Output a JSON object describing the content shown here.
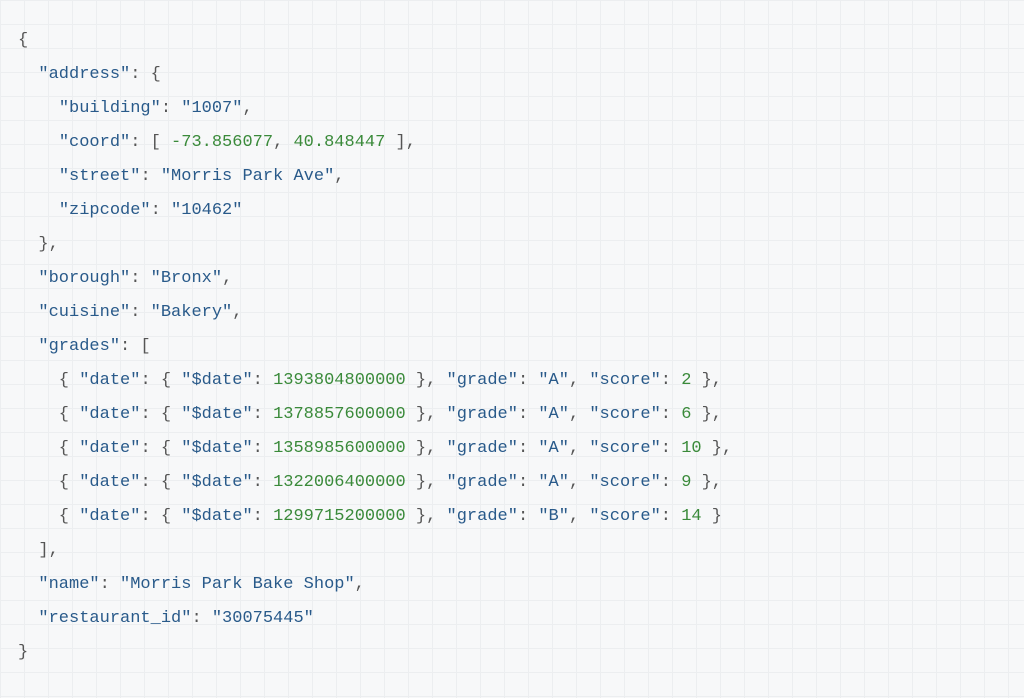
{
  "tokens": [
    [
      [
        "punct",
        "{"
      ]
    ],
    [
      [
        "punct",
        "  "
      ],
      [
        "key",
        "\"address\""
      ],
      [
        "punct",
        ": {"
      ]
    ],
    [
      [
        "punct",
        "    "
      ],
      [
        "key",
        "\"building\""
      ],
      [
        "punct",
        ": "
      ],
      [
        "string",
        "\"1007\""
      ],
      [
        "punct",
        ","
      ]
    ],
    [
      [
        "punct",
        "    "
      ],
      [
        "key",
        "\"coord\""
      ],
      [
        "punct",
        ": [ "
      ],
      [
        "number",
        "-73.856077"
      ],
      [
        "punct",
        ", "
      ],
      [
        "number",
        "40.848447"
      ],
      [
        "punct",
        " ],"
      ]
    ],
    [
      [
        "punct",
        "    "
      ],
      [
        "key",
        "\"street\""
      ],
      [
        "punct",
        ": "
      ],
      [
        "string",
        "\"Morris Park Ave\""
      ],
      [
        "punct",
        ","
      ]
    ],
    [
      [
        "punct",
        "    "
      ],
      [
        "key",
        "\"zipcode\""
      ],
      [
        "punct",
        ": "
      ],
      [
        "string",
        "\"10462\""
      ]
    ],
    [
      [
        "punct",
        "  },"
      ]
    ],
    [
      [
        "punct",
        "  "
      ],
      [
        "key",
        "\"borough\""
      ],
      [
        "punct",
        ": "
      ],
      [
        "string",
        "\"Bronx\""
      ],
      [
        "punct",
        ","
      ]
    ],
    [
      [
        "punct",
        "  "
      ],
      [
        "key",
        "\"cuisine\""
      ],
      [
        "punct",
        ": "
      ],
      [
        "string",
        "\"Bakery\""
      ],
      [
        "punct",
        ","
      ]
    ],
    [
      [
        "punct",
        "  "
      ],
      [
        "key",
        "\"grades\""
      ],
      [
        "punct",
        ": ["
      ]
    ],
    [
      [
        "punct",
        "    { "
      ],
      [
        "key",
        "\"date\""
      ],
      [
        "punct",
        ": { "
      ],
      [
        "key",
        "\"$date\""
      ],
      [
        "punct",
        ": "
      ],
      [
        "number",
        "1393804800000"
      ],
      [
        "punct",
        " }, "
      ],
      [
        "key",
        "\"grade\""
      ],
      [
        "punct",
        ": "
      ],
      [
        "string",
        "\"A\""
      ],
      [
        "punct",
        ", "
      ],
      [
        "key",
        "\"score\""
      ],
      [
        "punct",
        ": "
      ],
      [
        "number",
        "2"
      ],
      [
        "punct",
        " },"
      ]
    ],
    [
      [
        "punct",
        "    { "
      ],
      [
        "key",
        "\"date\""
      ],
      [
        "punct",
        ": { "
      ],
      [
        "key",
        "\"$date\""
      ],
      [
        "punct",
        ": "
      ],
      [
        "number",
        "1378857600000"
      ],
      [
        "punct",
        " }, "
      ],
      [
        "key",
        "\"grade\""
      ],
      [
        "punct",
        ": "
      ],
      [
        "string",
        "\"A\""
      ],
      [
        "punct",
        ", "
      ],
      [
        "key",
        "\"score\""
      ],
      [
        "punct",
        ": "
      ],
      [
        "number",
        "6"
      ],
      [
        "punct",
        " },"
      ]
    ],
    [
      [
        "punct",
        "    { "
      ],
      [
        "key",
        "\"date\""
      ],
      [
        "punct",
        ": { "
      ],
      [
        "key",
        "\"$date\""
      ],
      [
        "punct",
        ": "
      ],
      [
        "number",
        "1358985600000"
      ],
      [
        "punct",
        " }, "
      ],
      [
        "key",
        "\"grade\""
      ],
      [
        "punct",
        ": "
      ],
      [
        "string",
        "\"A\""
      ],
      [
        "punct",
        ", "
      ],
      [
        "key",
        "\"score\""
      ],
      [
        "punct",
        ": "
      ],
      [
        "number",
        "10"
      ],
      [
        "punct",
        " },"
      ]
    ],
    [
      [
        "punct",
        "    { "
      ],
      [
        "key",
        "\"date\""
      ],
      [
        "punct",
        ": { "
      ],
      [
        "key",
        "\"$date\""
      ],
      [
        "punct",
        ": "
      ],
      [
        "number",
        "1322006400000"
      ],
      [
        "punct",
        " }, "
      ],
      [
        "key",
        "\"grade\""
      ],
      [
        "punct",
        ": "
      ],
      [
        "string",
        "\"A\""
      ],
      [
        "punct",
        ", "
      ],
      [
        "key",
        "\"score\""
      ],
      [
        "punct",
        ": "
      ],
      [
        "number",
        "9"
      ],
      [
        "punct",
        " },"
      ]
    ],
    [
      [
        "punct",
        "    { "
      ],
      [
        "key",
        "\"date\""
      ],
      [
        "punct",
        ": { "
      ],
      [
        "key",
        "\"$date\""
      ],
      [
        "punct",
        ": "
      ],
      [
        "number",
        "1299715200000"
      ],
      [
        "punct",
        " }, "
      ],
      [
        "key",
        "\"grade\""
      ],
      [
        "punct",
        ": "
      ],
      [
        "string",
        "\"B\""
      ],
      [
        "punct",
        ", "
      ],
      [
        "key",
        "\"score\""
      ],
      [
        "punct",
        ": "
      ],
      [
        "number",
        "14"
      ],
      [
        "punct",
        " }"
      ]
    ],
    [
      [
        "punct",
        "  ],"
      ]
    ],
    [
      [
        "punct",
        "  "
      ],
      [
        "key",
        "\"name\""
      ],
      [
        "punct",
        ": "
      ],
      [
        "string",
        "\"Morris Park Bake Shop\""
      ],
      [
        "punct",
        ","
      ]
    ],
    [
      [
        "punct",
        "  "
      ],
      [
        "key",
        "\"restaurant_id\""
      ],
      [
        "punct",
        ": "
      ],
      [
        "string",
        "\"30075445\""
      ]
    ],
    [
      [
        "punct",
        "}"
      ]
    ]
  ],
  "document": {
    "address": {
      "building": "1007",
      "coord": [
        -73.856077,
        40.848447
      ],
      "street": "Morris Park Ave",
      "zipcode": "10462"
    },
    "borough": "Bronx",
    "cuisine": "Bakery",
    "grades": [
      {
        "date": {
          "$date": 1393804800000
        },
        "grade": "A",
        "score": 2
      },
      {
        "date": {
          "$date": 1378857600000
        },
        "grade": "A",
        "score": 6
      },
      {
        "date": {
          "$date": 1358985600000
        },
        "grade": "A",
        "score": 10
      },
      {
        "date": {
          "$date": 1322006400000
        },
        "grade": "A",
        "score": 9
      },
      {
        "date": {
          "$date": 1299715200000
        },
        "grade": "B",
        "score": 14
      }
    ],
    "name": "Morris Park Bake Shop",
    "restaurant_id": "30075445"
  }
}
